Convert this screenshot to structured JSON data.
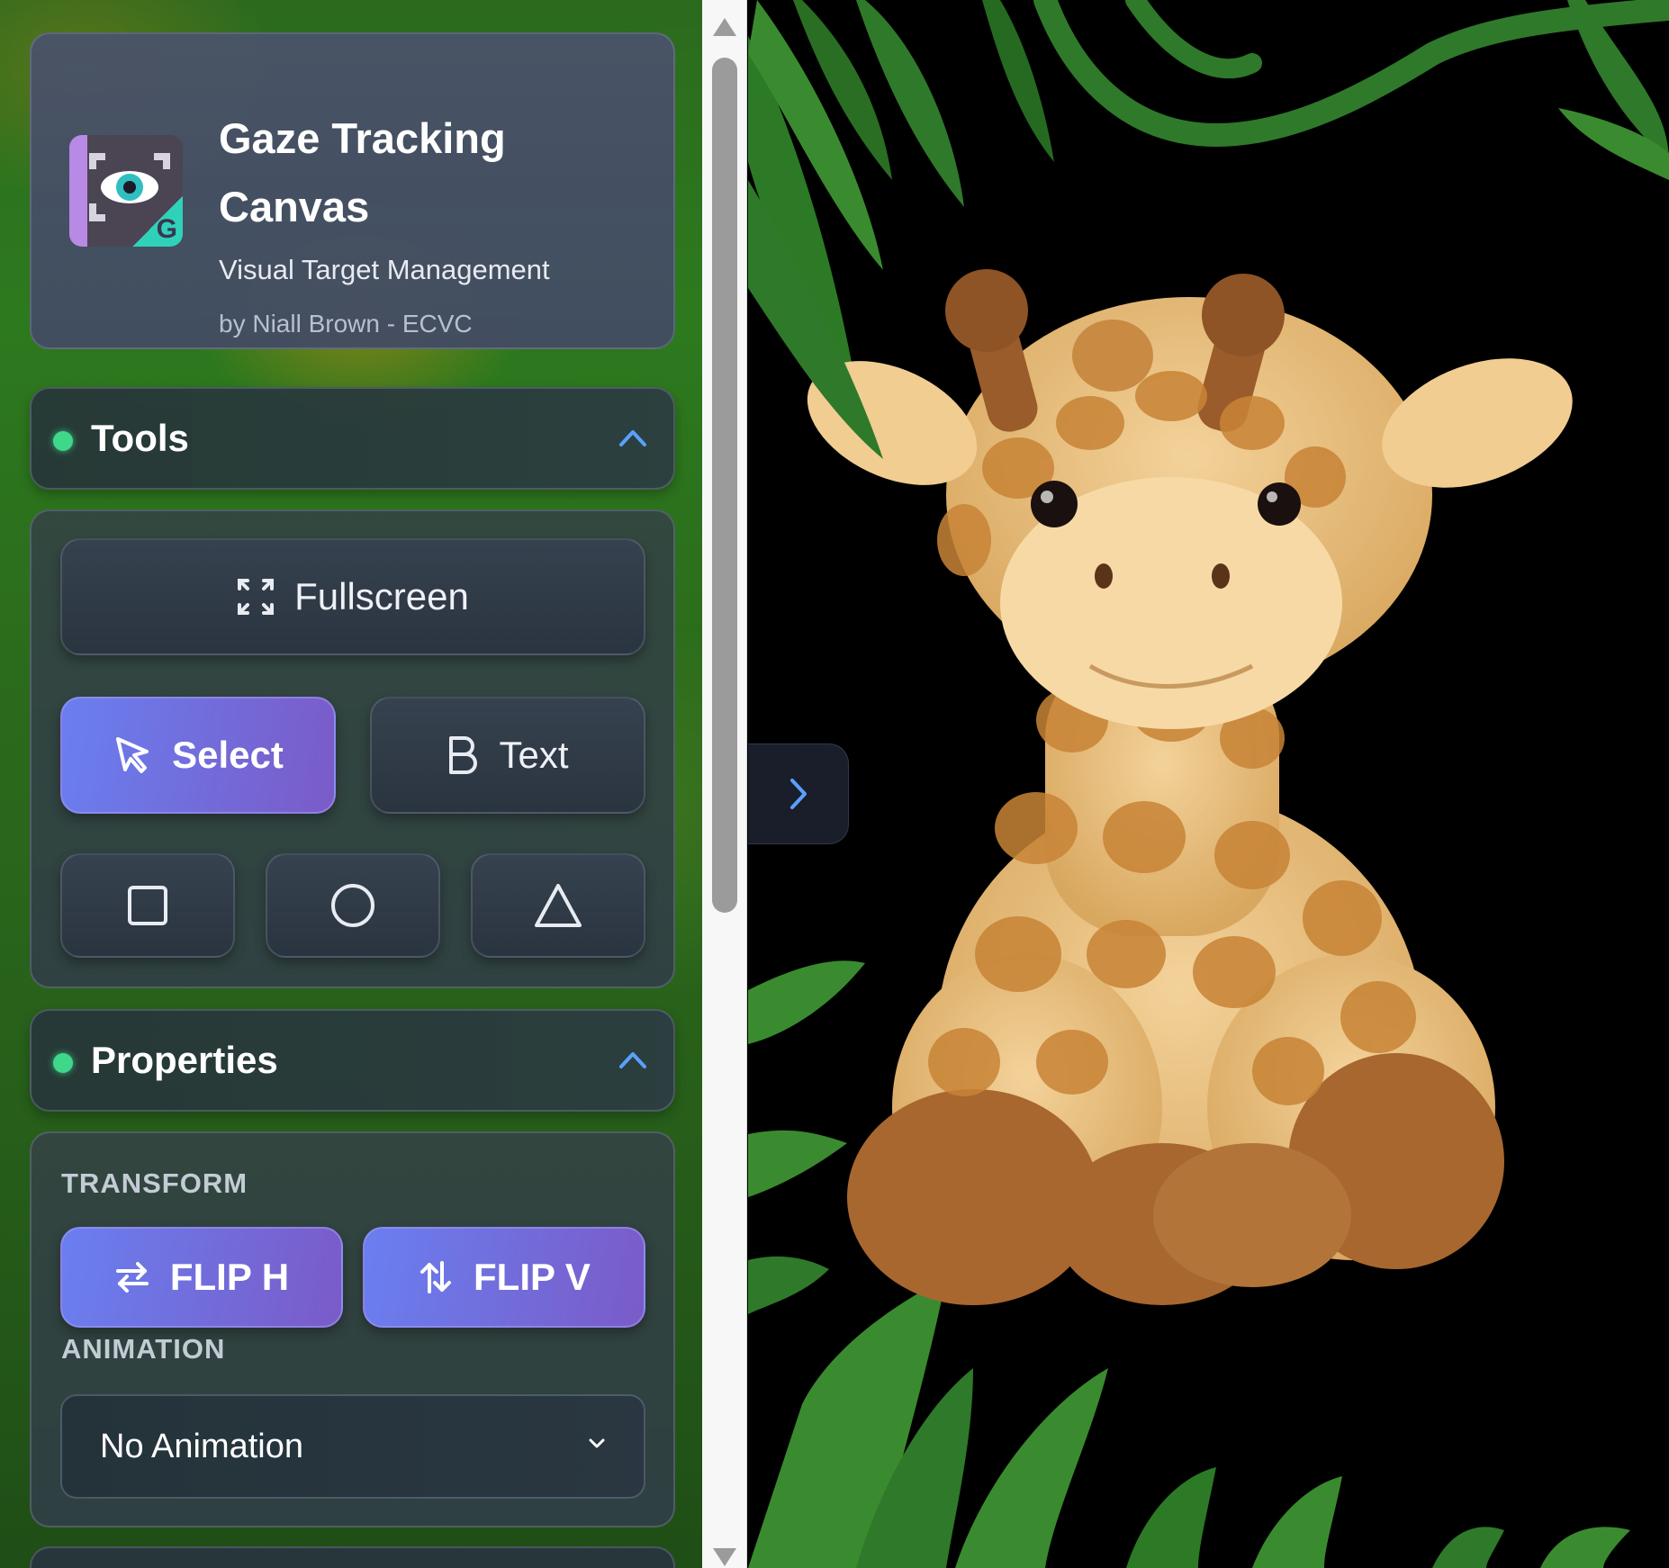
{
  "app": {
    "title": "Gaze Tracking Canvas",
    "subtitle": "Visual Target Management",
    "author": "by Niall Brown - ECVC"
  },
  "tools": {
    "section_label": "Tools",
    "fullscreen_label": "Fullscreen",
    "select_label": "Select",
    "text_label": "Text",
    "shapes": [
      "rectangle",
      "circle",
      "triangle"
    ]
  },
  "properties": {
    "section_label": "Properties",
    "transform_label": "TRANSFORM",
    "flip_h_label": "FLIP H",
    "flip_v_label": "FLIP V",
    "animation_label": "ANIMATION",
    "animation_value": "No Animation"
  },
  "colors": {
    "accent_start": "#6a7ff0",
    "accent_end": "#7a5bc8",
    "status_dot": "#3fd88a",
    "chevron": "#5aa0ff"
  },
  "canvas": {
    "image_subject": "plush giraffe toy with jungle leaves on black background"
  }
}
